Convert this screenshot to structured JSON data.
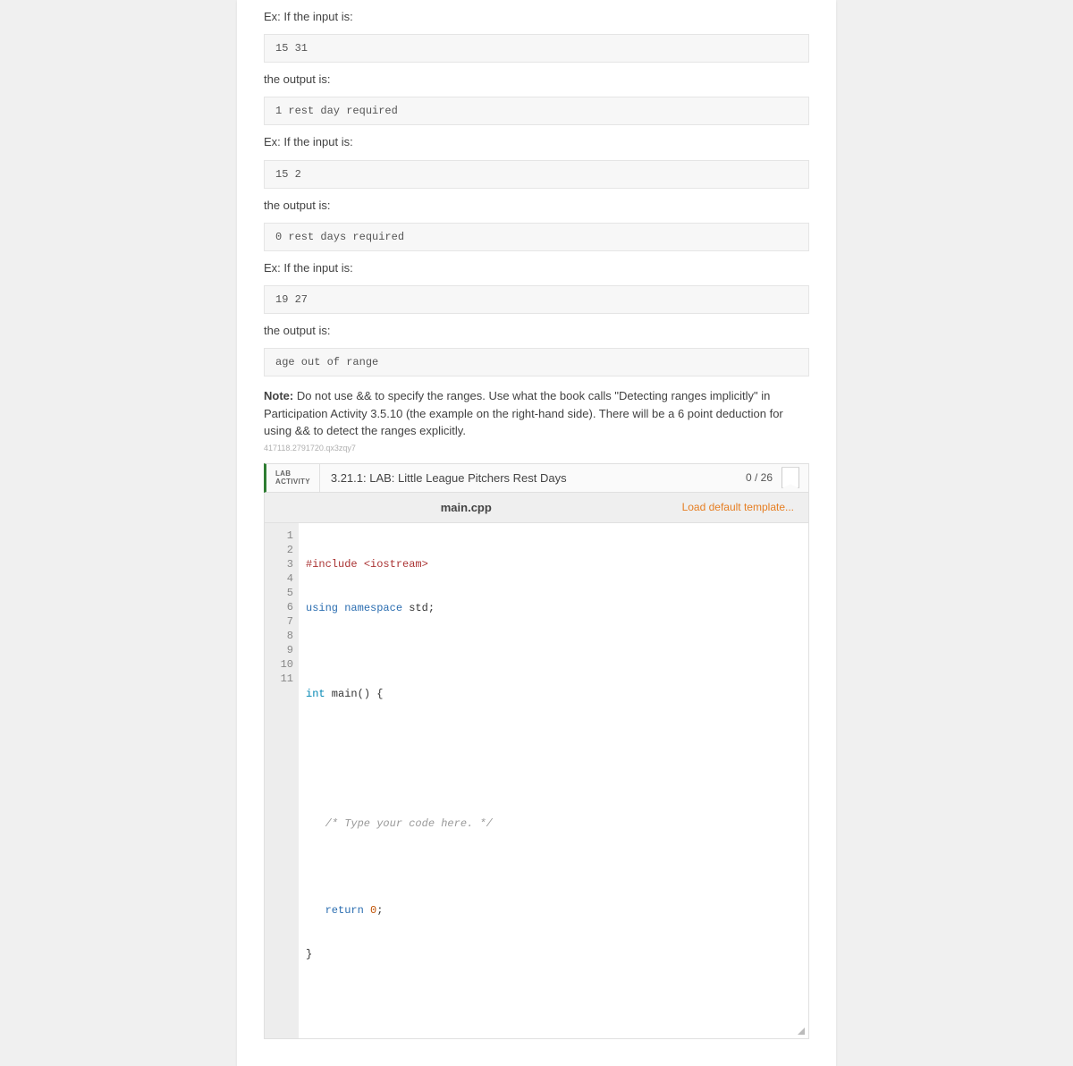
{
  "examples": [
    {
      "prompt": "Ex: If the input is:",
      "input": "15 31",
      "outlabel": "the output is:",
      "output": "1 rest day required"
    },
    {
      "prompt": "Ex: If the input is:",
      "input": "15 2",
      "outlabel": "the output is:",
      "output": "0 rest days required"
    },
    {
      "prompt": "Ex: If the input is:",
      "input": "19 27",
      "outlabel": "the output is:",
      "output": "age out of range"
    }
  ],
  "note": {
    "label": "Note:",
    "body": " Do not use && to specify the ranges. Use what the book calls \"Detecting ranges implicitly\" in Participation Activity 3.5.10 (the example on the right-hand side). There will be a 6 point deduction for using && to detect the ranges explicitly."
  },
  "tinyid": "417118.2791720.qx3zqy7",
  "activity": {
    "type_line1": "LAB",
    "type_line2": "ACTIVITY",
    "title": "3.21.1: LAB: Little League Pitchers Rest Days",
    "score": "0 / 26"
  },
  "editor": {
    "filename": "main.cpp",
    "load_default": "Load default template...",
    "gutter": [
      "1",
      "2",
      "3",
      "4",
      "5",
      "6",
      "7",
      "8",
      "9",
      "10",
      "11"
    ],
    "code": {
      "l1a": "#include ",
      "l1b": "<iostream>",
      "l2a": "using ",
      "l2b": "namespace",
      "l2c": " std;",
      "l4a": "int",
      "l4b": " main",
      "l4c": "() {",
      "l7": "   /* Type your code here. */",
      "l9a": "   return ",
      "l9b": "0",
      "l9c": ";",
      "l10": "}"
    }
  }
}
